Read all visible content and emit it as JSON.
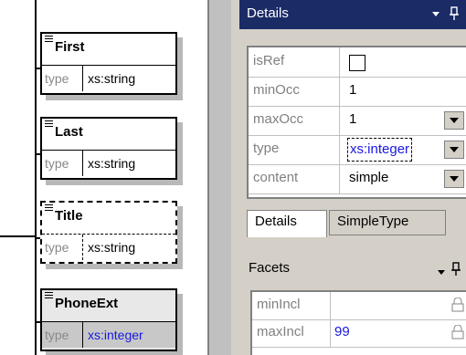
{
  "diagram": {
    "elements": [
      {
        "name": "First",
        "type_key": "type",
        "type_value": "xs:string"
      },
      {
        "name": "Last",
        "type_key": "type",
        "type_value": "xs:string"
      },
      {
        "name": "Title",
        "type_key": "type",
        "type_value": "xs:string"
      },
      {
        "name": "PhoneExt",
        "type_key": "type",
        "type_value": "xs:integer"
      }
    ]
  },
  "details": {
    "title": "Details",
    "properties": [
      {
        "key": "isRef",
        "value": ""
      },
      {
        "key": "minOcc",
        "value": "1"
      },
      {
        "key": "maxOcc",
        "value": "1"
      },
      {
        "key": "type",
        "value": "xs:integer"
      },
      {
        "key": "content",
        "value": "simple"
      }
    ],
    "tabs": [
      "Details",
      "SimpleType"
    ]
  },
  "facets": {
    "title": "Facets",
    "rows": [
      {
        "key": "minIncl",
        "value": ""
      },
      {
        "key": "maxIncl",
        "value": "99"
      }
    ]
  },
  "colors": {
    "titlebar": "#1a2b66",
    "value_blue": "#1818e0",
    "panel_gray": "#d4d0c8"
  }
}
